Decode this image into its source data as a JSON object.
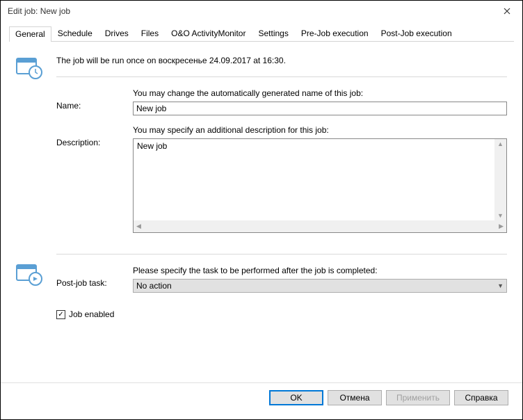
{
  "window": {
    "title": "Edit job: New job"
  },
  "tabs": {
    "general": "General",
    "schedule": "Schedule",
    "drives": "Drives",
    "files": "Files",
    "activity": "O&O ActivityMonitor",
    "settings": "Settings",
    "pre": "Pre-Job execution",
    "post": "Post-Job execution"
  },
  "general": {
    "schedule_info": "The job will be run once on воскресенье 24.09.2017 at 16:30.",
    "name_label": "Name:",
    "name_hint": "You may change the automatically generated name of this job:",
    "name_value": "New job",
    "desc_label": "Description:",
    "desc_hint": "You may specify an additional description for this job:",
    "desc_value": "New job",
    "posttask_label": "Post-job task:",
    "posttask_hint": "Please specify the task to be performed after the job is completed:",
    "posttask_value": "No action",
    "enabled_label": "Job enabled"
  },
  "buttons": {
    "ok": "OK",
    "cancel": "Отмена",
    "apply": "Применить",
    "help": "Справка"
  }
}
